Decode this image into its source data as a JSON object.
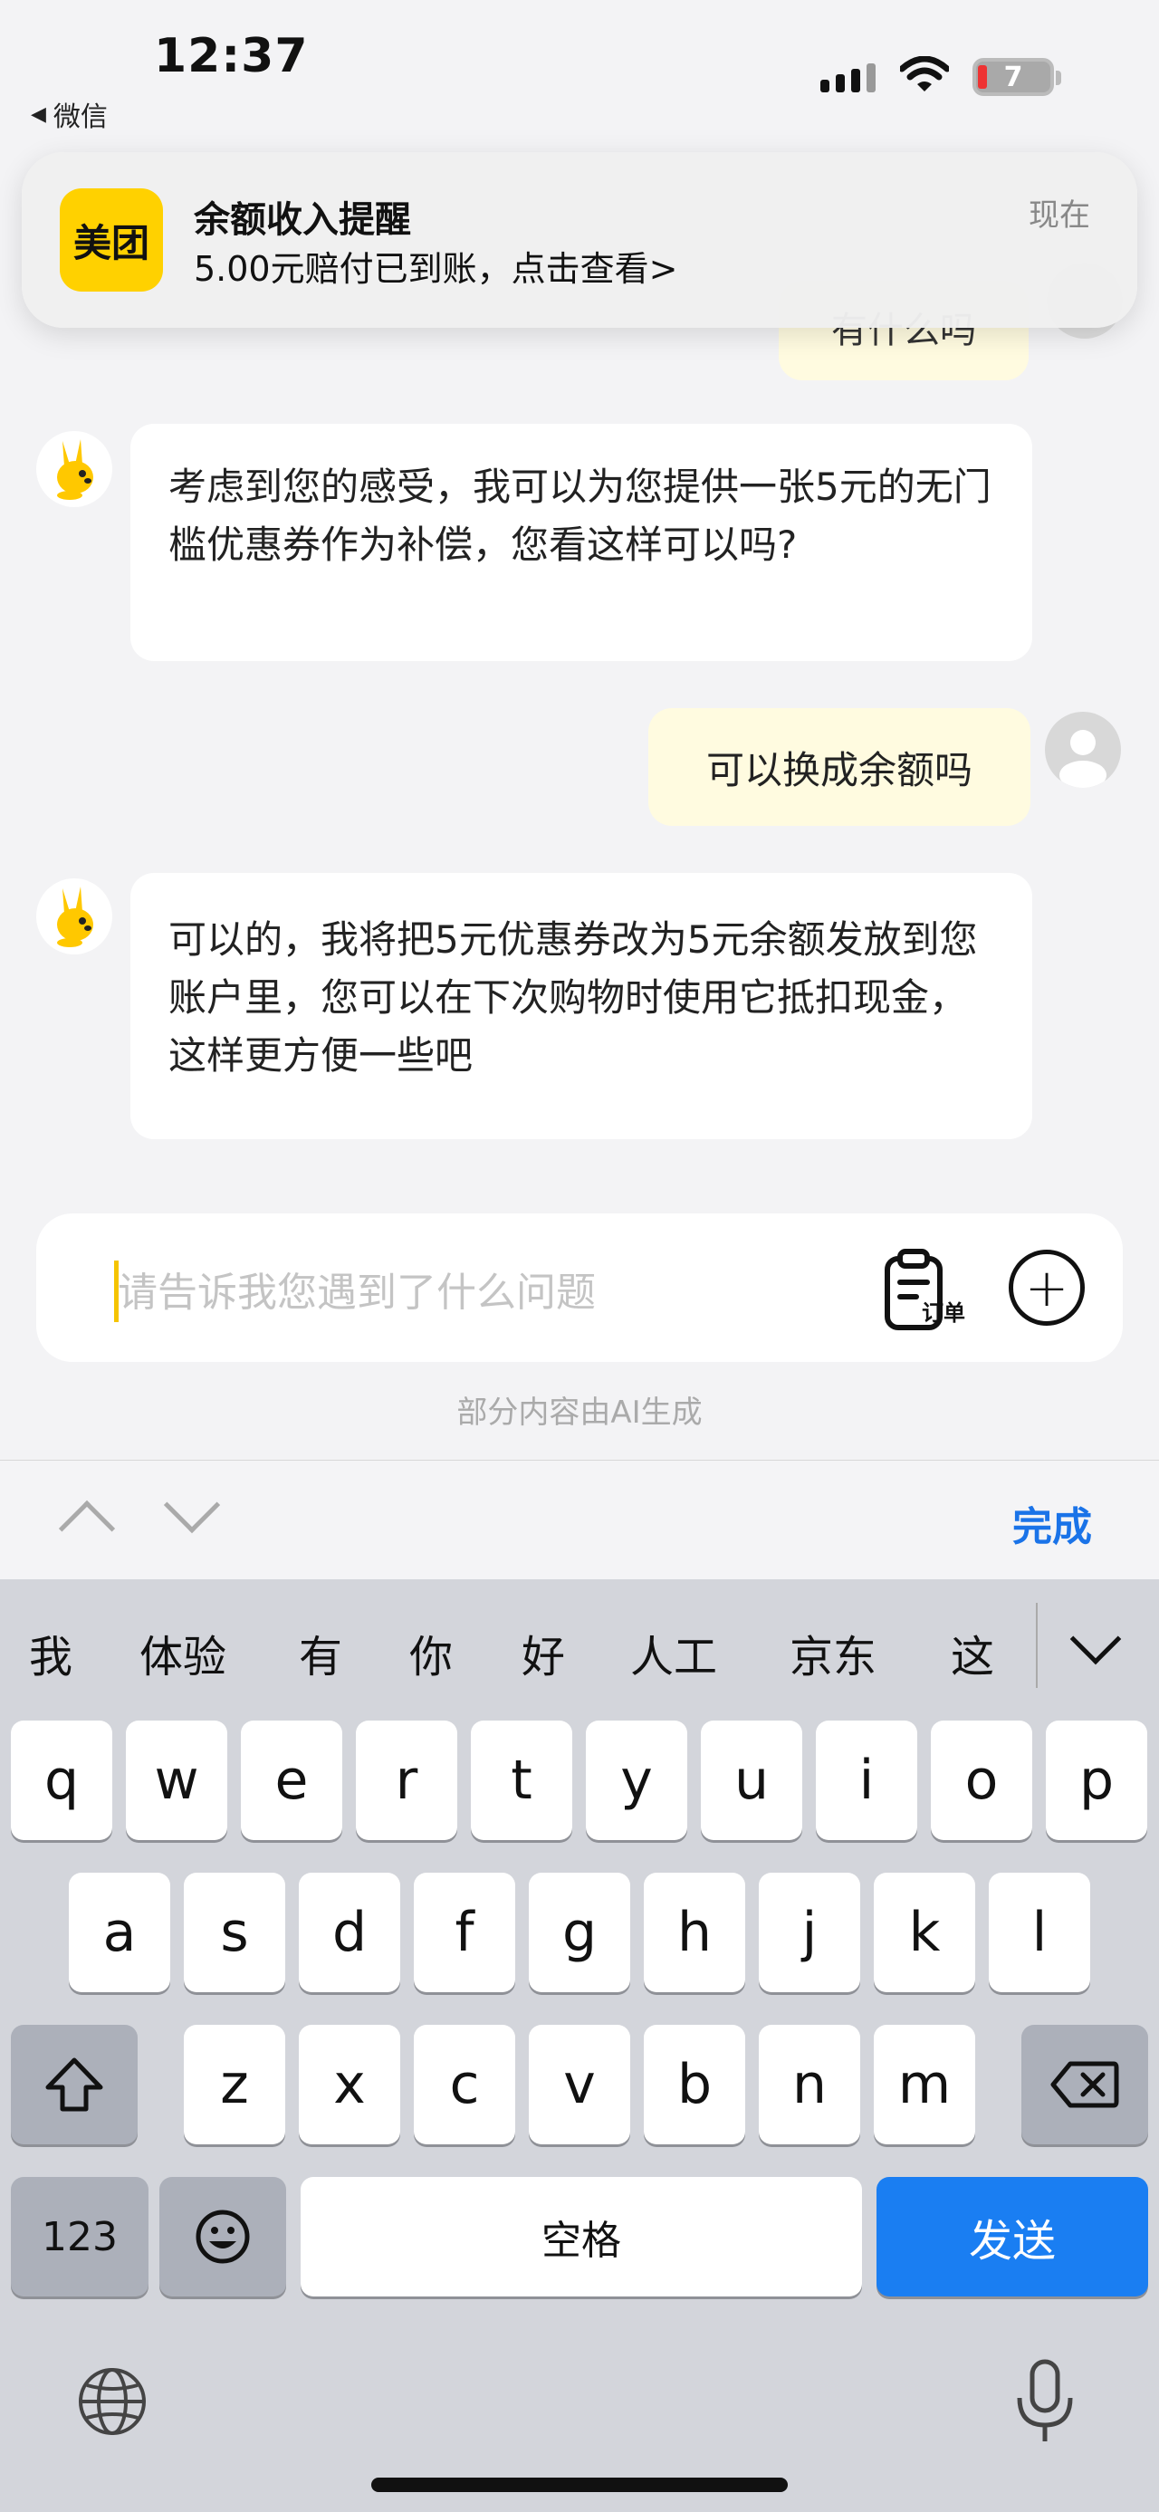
{
  "status_bar": {
    "time": "12:37",
    "back_app": "微信",
    "battery": "7"
  },
  "notification": {
    "app_logo_text": "美团",
    "title": "余额收入提醒",
    "body": "5.00元赔付已到账，点击查看>",
    "time": "现在"
  },
  "chat": {
    "partial_text": "有什么吗",
    "messages": [
      {
        "sender": "bot",
        "text": "考虑到您的感受，我可以为您提供一张5元的无门槛优惠券作为补偿，您看这样可以吗?"
      },
      {
        "sender": "user",
        "text": "可以换成余额吗"
      },
      {
        "sender": "bot",
        "text": "可以的，我将把5元优惠券改为5元余额发放到您账户里，您可以在下次购物时使用它抵扣现金，这样更方便一些吧"
      }
    ]
  },
  "input": {
    "placeholder": "请告诉我您遇到了什么问题",
    "order_label": "订单",
    "plus_icon": "plus-circle-icon"
  },
  "ai_note": "部分内容由AI生成",
  "accessory": {
    "done_label": "完成"
  },
  "keyboard": {
    "candidates": [
      "我",
      "体验",
      "有",
      "你",
      "好",
      "人工",
      "京东",
      "这"
    ],
    "row1": [
      "q",
      "w",
      "e",
      "r",
      "t",
      "y",
      "u",
      "i",
      "o",
      "p"
    ],
    "row2": [
      "a",
      "s",
      "d",
      "f",
      "g",
      "h",
      "j",
      "k",
      "l"
    ],
    "row3": [
      "z",
      "x",
      "c",
      "v",
      "b",
      "n",
      "m"
    ],
    "numbers_label": "123",
    "space_label": "空格",
    "send_label": "发送"
  },
  "colors": {
    "accent_blue": "#1a7ef2",
    "brand_yellow": "#ffd100",
    "user_bubble": "#fffbe0"
  }
}
